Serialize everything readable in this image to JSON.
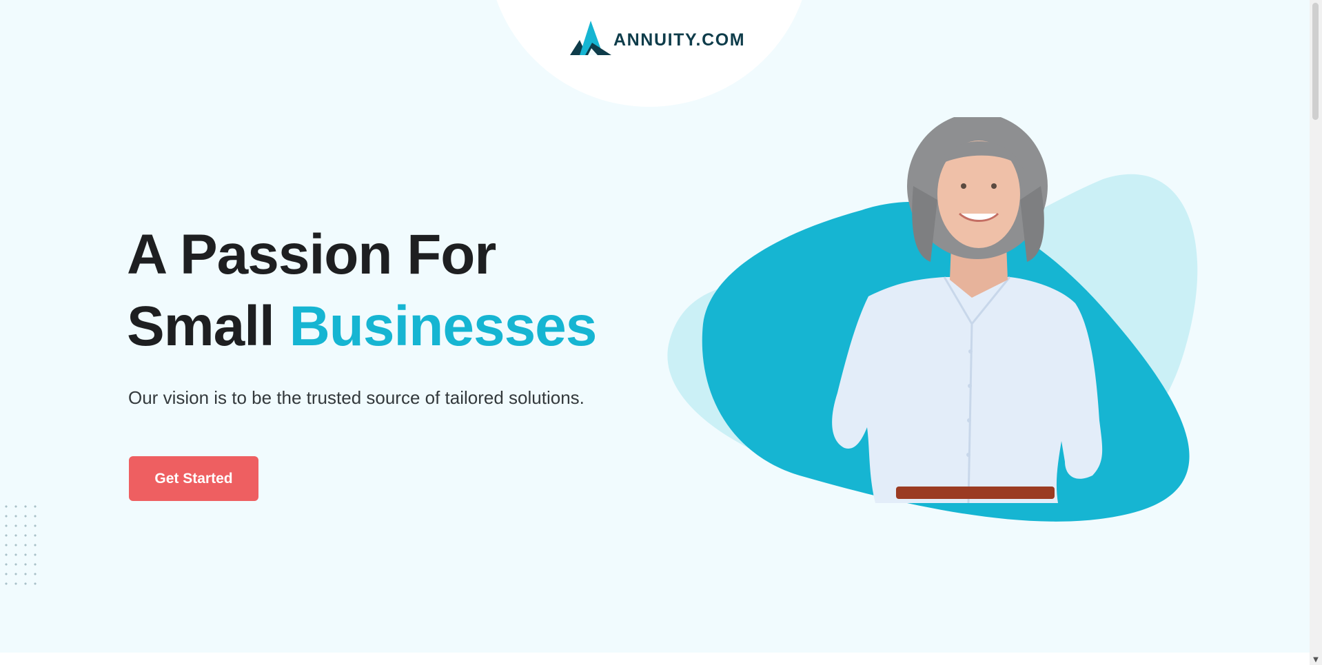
{
  "brand": {
    "logo_icon": "mountain-logo-icon",
    "name": "ANNUITY.COM",
    "colors": {
      "dark": "#0e3c4a",
      "teal": "#16b5d2",
      "light_teal": "#cbf0f6"
    }
  },
  "hero": {
    "headline_line1": "A Passion For",
    "headline_line2_plain": "Small",
    "headline_line2_accent": "Businesses",
    "subtitle": "Our vision is to be the trusted source of tailored solutions.",
    "cta_label": "Get Started",
    "image": "smiling-woman-photo"
  },
  "colors": {
    "background": "#f1fbfe",
    "headline": "#1e1f21",
    "accent": "#16b5d2",
    "cta": "#ee5f61"
  }
}
